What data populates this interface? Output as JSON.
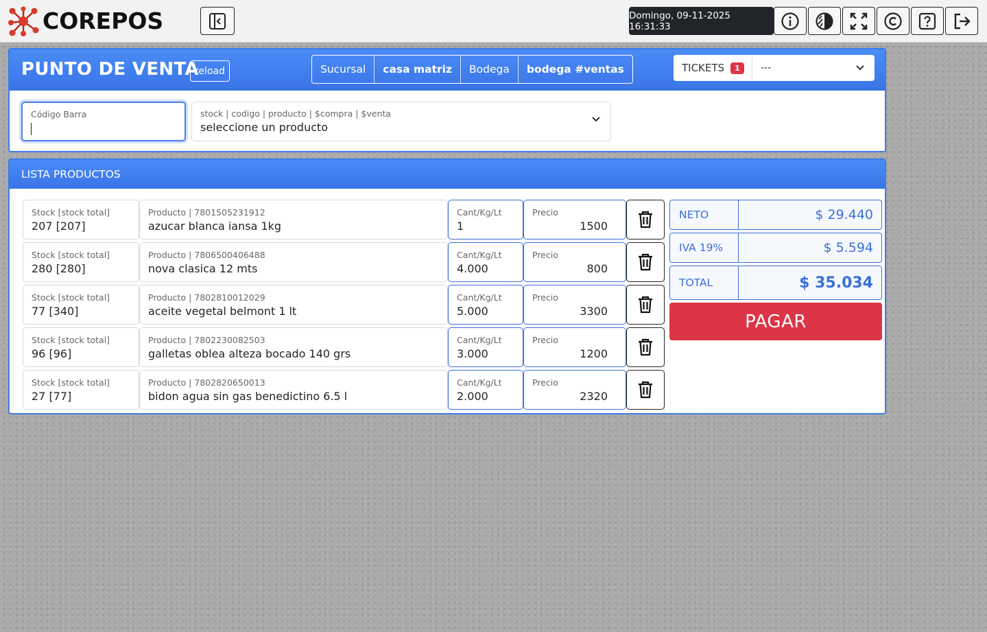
{
  "header": {
    "logo_text": "COREPOS",
    "datetime": "Domingo, 09-11-2025 16:31:33",
    "buttons": [
      {
        "name": "info-button",
        "icon": "info-icon"
      },
      {
        "name": "theme-button",
        "icon": "contrast-icon"
      },
      {
        "name": "fullscreen-button",
        "icon": "fullscreen-icon"
      },
      {
        "name": "copyright-button",
        "icon": "copyright-icon"
      },
      {
        "name": "help-button",
        "icon": "help-icon"
      },
      {
        "name": "logout-button",
        "icon": "logout-icon"
      }
    ]
  },
  "pos": {
    "title": "PUNTO DE VENTA",
    "reload_label": "reload",
    "sucursal_label": "Sucursal",
    "sucursal_value": "casa matriz",
    "bodega_label": "Bodega",
    "bodega_value": "bodega #ventas",
    "tickets_label": "TICKETS",
    "tickets_count": "1",
    "tickets_selected": "---",
    "barcode_label": "Código Barra",
    "barcode_value": "",
    "product_select_label": "stock | codigo | producto | $compra | $venta",
    "product_select_value": "seleccione un producto"
  },
  "list": {
    "title": "LISTA PRODUCTOS",
    "stock_label": "Stock [stock total]",
    "qty_label": "Cant/Kg/Lt",
    "price_label": "Precio",
    "rows": [
      {
        "stock": "207 [207]",
        "product_label": "Producto | 7801505231912",
        "product": "azucar blanca iansa 1kg",
        "qty": "1",
        "price": "1500"
      },
      {
        "stock": "280 [280]",
        "product_label": "Producto | 7806500406488",
        "product": "nova clasica 12 mts",
        "qty": "4.000",
        "price": "800"
      },
      {
        "stock": "77 [340]",
        "product_label": "Producto | 7802810012029",
        "product": "aceite vegetal belmont 1 lt",
        "qty": "5.000",
        "price": "3300"
      },
      {
        "stock": "96 [96]",
        "product_label": "Producto | 7802230082503",
        "product": "galletas oblea alteza bocado 140 grs",
        "qty": "3.000",
        "price": "1200"
      },
      {
        "stock": "27 [77]",
        "product_label": "Producto | 7802820650013",
        "product": "bidon agua sin gas benedictino 6.5 l",
        "qty": "2.000",
        "price": "2320"
      }
    ]
  },
  "totals": {
    "neto_label": "NETO",
    "neto_value": "$ 29.440",
    "iva_label": "IVA 19%",
    "iva_value": "$ 5.594",
    "total_label": "TOTAL",
    "total_value": "$ 35.034",
    "pay_label": "PAGAR"
  },
  "colors": {
    "accent": "#3b7be8",
    "pay": "#dc3545",
    "header_dark": "#212529"
  }
}
